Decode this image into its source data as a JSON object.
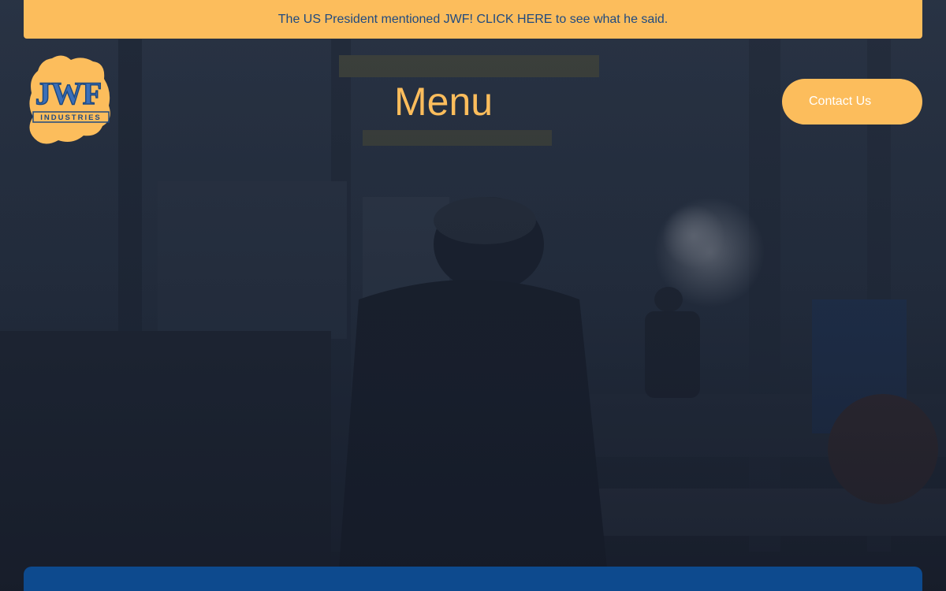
{
  "announcement": {
    "text": "The US President mentioned JWF! CLICK HERE to see what he said."
  },
  "logo": {
    "wordmark": "JWF",
    "subtext": "INDUSTRIES"
  },
  "nav": {
    "menu_label": "Menu",
    "contact_label": "Contact Us"
  },
  "colors": {
    "accent": "#fcbd5c",
    "brand_blue": "#1f4a80",
    "panel_blue": "#0d4a8e"
  }
}
